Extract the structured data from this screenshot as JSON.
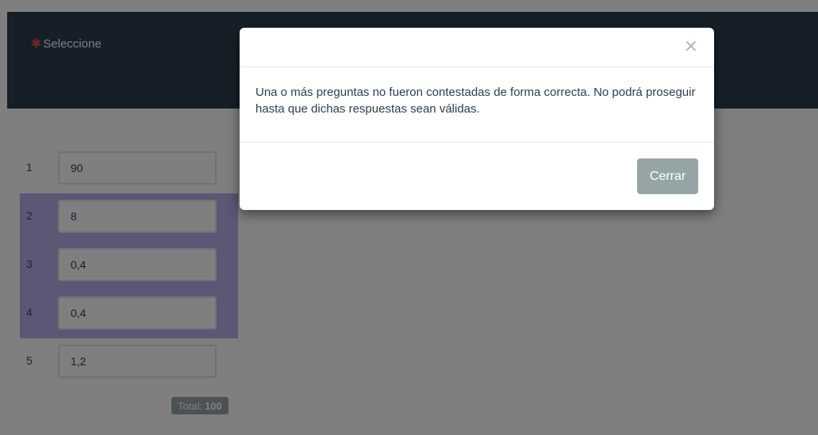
{
  "header": {
    "required_marker": "✱",
    "label": "Seleccione"
  },
  "rows": [
    {
      "number": "1",
      "value": "90",
      "highlighted": false
    },
    {
      "number": "2",
      "value": "8",
      "highlighted": true
    },
    {
      "number": "3",
      "value": "0,4",
      "highlighted": true
    },
    {
      "number": "4",
      "value": "0,4",
      "highlighted": true
    },
    {
      "number": "5",
      "value": "1,2",
      "highlighted": false
    }
  ],
  "total": {
    "label": "Total:",
    "value": "100"
  },
  "modal": {
    "close_icon": "×",
    "message": "Una o más preguntas no fueron contestadas de forma correcta. No podrá proseguir hasta que dichas respuestas sean válidas.",
    "close_button_label": "Cerrar"
  },
  "colors": {
    "header_bg": "#2c3e50",
    "highlight": "#b6aee9",
    "required": "#e74c3c",
    "button": "#95a5a6"
  }
}
